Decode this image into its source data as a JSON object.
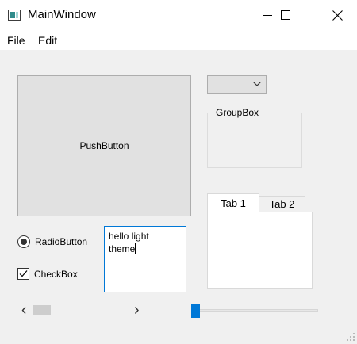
{
  "window": {
    "title": "MainWindow"
  },
  "menu": {
    "items": [
      "File",
      "Edit"
    ]
  },
  "push_button": {
    "label": "PushButton"
  },
  "combo_box": {
    "value": ""
  },
  "group_box": {
    "title": "GroupBox"
  },
  "tabs": {
    "items": [
      {
        "label": "Tab 1",
        "selected": true
      },
      {
        "label": "Tab 2",
        "selected": false
      }
    ]
  },
  "radio": {
    "label": "RadioButton",
    "checked": true
  },
  "checkbox": {
    "label": "CheckBox",
    "checked": true
  },
  "text_edit": {
    "value": "hello light\ntheme"
  },
  "scrollbar": {
    "position": 0.0
  },
  "slider": {
    "value": 0
  },
  "colors": {
    "accent": "#0078d7",
    "window_bg": "#f0f0f0",
    "button_bg": "#e1e1e1"
  }
}
